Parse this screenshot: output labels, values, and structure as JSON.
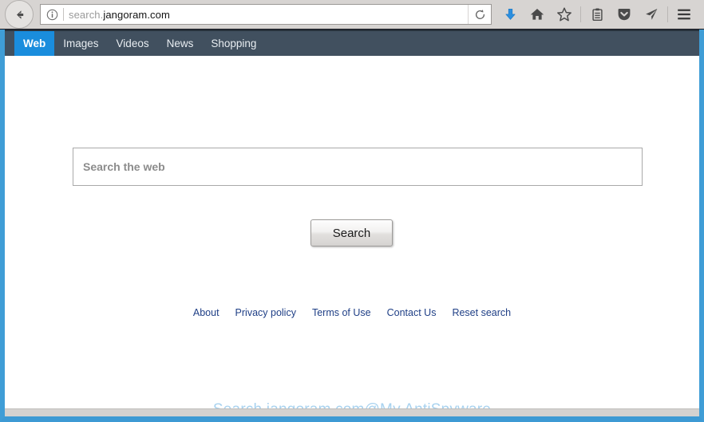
{
  "browser": {
    "back_label": "Back",
    "identity_icon": "info-circle-icon",
    "url_scheme_dim": "search.",
    "url_host": "jangoram.com",
    "url_full": "search.jangoram.com",
    "reload_label": "Reload",
    "toolbar_icons": [
      {
        "name": "download-icon",
        "label": "Downloads",
        "color": "#2b8fe0"
      },
      {
        "name": "home-icon",
        "label": "Home",
        "color": "#4a4a4a"
      },
      {
        "name": "star-icon",
        "label": "Bookmark this page",
        "color": "#4a4a4a"
      },
      {
        "name": "library-icon",
        "label": "Library",
        "color": "#4a4a4a"
      },
      {
        "name": "pocket-icon",
        "label": "Save to Pocket",
        "color": "#4a4a4a"
      },
      {
        "name": "send-icon",
        "label": "Send tab",
        "color": "#4a4a4a"
      },
      {
        "name": "hamburger-menu-icon",
        "label": "Open menu",
        "color": "#3a3a3a"
      }
    ]
  },
  "site": {
    "nav_tabs": [
      {
        "label": "Web",
        "active": true
      },
      {
        "label": "Images",
        "active": false
      },
      {
        "label": "Videos",
        "active": false
      },
      {
        "label": "News",
        "active": false
      },
      {
        "label": "Shopping",
        "active": false
      }
    ],
    "search": {
      "placeholder": "Search the web",
      "value": "",
      "button_label": "Search"
    },
    "footer_links": [
      "About",
      "Privacy policy",
      "Terms of Use",
      "Contact Us",
      "Reset search"
    ],
    "watermark": "Search.jangoram.com@My AntiSpyware"
  },
  "colors": {
    "nav_bar": "#41505f",
    "active_tab": "#1a8ddd",
    "page_border": "#3f9dd6",
    "link": "#1f3f86",
    "watermark": "#a8d2ef"
  }
}
